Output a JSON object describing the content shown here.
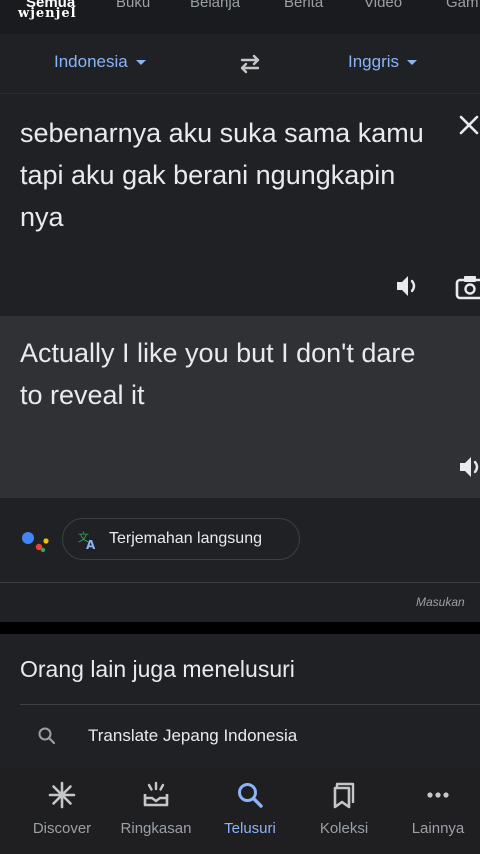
{
  "top_tabs": [
    "Semua",
    "Buku",
    "Belanja",
    "Berita",
    "Video",
    "Gam"
  ],
  "watermark": "wjenjel",
  "translator": {
    "source_lang": "Indonesia",
    "target_lang": "Inggris",
    "source_text": "sebenarnya aku suka sama kamu tapi aku gak berani ngungkapin nya",
    "translated_text": "Actually I like you but I don't dare to reveal it",
    "live_translate_label": "Terjemahan langsung",
    "feedback_label": "Masukan"
  },
  "related": {
    "title": "Orang lain juga menelusuri",
    "items": [
      "Translate Jepang Indonesia"
    ]
  },
  "bottom_nav": {
    "items": [
      {
        "label": "Discover",
        "icon": "asterisk-icon"
      },
      {
        "label": "Ringkasan",
        "icon": "summary-icon"
      },
      {
        "label": "Telusuri",
        "icon": "search-icon",
        "active": true
      },
      {
        "label": "Koleksi",
        "icon": "collections-icon"
      },
      {
        "label": "Lainnya",
        "icon": "more-icon"
      }
    ]
  },
  "colors": {
    "accent": "#8ab4f8",
    "surface": "#202124",
    "result_surface": "#303134",
    "text": "#e8eaed",
    "muted": "#9aa0a6"
  }
}
